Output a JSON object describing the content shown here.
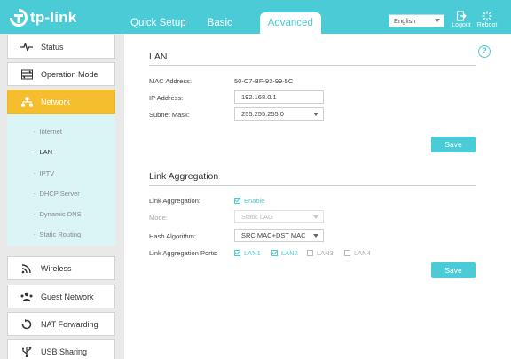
{
  "header": {
    "logo_text": "tp-link",
    "tabs": [
      {
        "label": "Quick Setup"
      },
      {
        "label": "Basic"
      },
      {
        "label": "Advanced"
      }
    ],
    "language": {
      "selected": "English"
    },
    "logout_label": "Logout",
    "reboot_label": "Reboot"
  },
  "sidebar": {
    "items": [
      {
        "label": "Status",
        "icon": "pulse-icon"
      },
      {
        "label": "Operation Mode",
        "icon": "operation-mode-icon"
      },
      {
        "label": "Network",
        "icon": "network-icon"
      },
      {
        "label": "Wireless",
        "icon": "wifi-icon"
      },
      {
        "label": "Guest Network",
        "icon": "guest-network-icon"
      },
      {
        "label": "NAT Forwarding",
        "icon": "nat-forwarding-icon"
      },
      {
        "label": "USB Sharing",
        "icon": "usb-icon"
      }
    ],
    "network_submenu": [
      {
        "label": "Internet"
      },
      {
        "label": "LAN"
      },
      {
        "label": "IPTV"
      },
      {
        "label": "DHCP Server"
      },
      {
        "label": "Dynamic DNS"
      },
      {
        "label": "Static Routing"
      }
    ]
  },
  "lan": {
    "title": "LAN",
    "mac_label": "MAC Address:",
    "mac_value": "50-C7-BF-93-99-5C",
    "ip_label": "IP Address:",
    "ip_value": "192.168.0.1",
    "mask_label": "Subnet Mask:",
    "mask_value": "255.255.255.0",
    "save_label": "Save"
  },
  "link_aggregation": {
    "title": "Link Aggregation",
    "la_label": "Link Aggregation:",
    "enable_label": "Enable",
    "enabled": true,
    "mode_label": "Mode:",
    "mode_value": "Static LAG",
    "hash_label": "Hash Algorithm:",
    "hash_value": "SRC MAC+DST MAC",
    "ports_label": "Link Aggregation Ports:",
    "ports": [
      {
        "label": "LAN1",
        "checked": true
      },
      {
        "label": "LAN2",
        "checked": true
      },
      {
        "label": "LAN3",
        "checked": false
      },
      {
        "label": "LAN4",
        "checked": false
      }
    ],
    "save_label": "Save"
  },
  "colors": {
    "accent": "#4acbd6",
    "active_menu": "#f4be2f",
    "submenu_bg": "#dbf4f6"
  }
}
